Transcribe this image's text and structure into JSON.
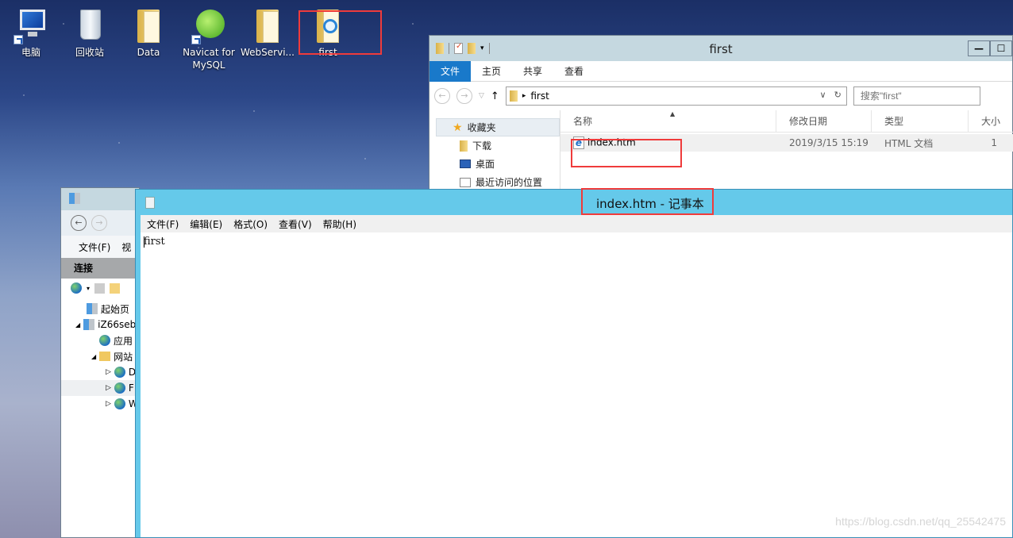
{
  "desktop": {
    "icons": [
      {
        "label": "电脑",
        "icon": "computer-icon",
        "shortcut": true
      },
      {
        "label": "回收站",
        "icon": "recycle-bin-icon",
        "shortcut": false
      },
      {
        "label": "Data",
        "icon": "folder-icon",
        "shortcut": false
      },
      {
        "label": "Navicat for MySQL",
        "icon": "navicat-icon",
        "shortcut": true
      },
      {
        "label": "WebServi...",
        "icon": "folder-icon",
        "shortcut": false
      },
      {
        "label": "first",
        "icon": "folder-ie-icon",
        "shortcut": false
      }
    ],
    "highlight_color": "#ef3b3b"
  },
  "explorer": {
    "title": "first",
    "ribbon_tabs": [
      "文件",
      "主页",
      "共享",
      "查看"
    ],
    "address": {
      "crumb_arrow": "▸",
      "path": "first"
    },
    "search_placeholder": "搜索\"first\"",
    "sidebar": [
      {
        "label": "收藏夹",
        "icon": "star-icon"
      },
      {
        "label": "下载",
        "icon": "download-folder-icon"
      },
      {
        "label": "桌面",
        "icon": "desktop-icon"
      },
      {
        "label": "最近访问的位置",
        "icon": "recent-places-icon"
      }
    ],
    "columns": [
      "名称",
      "修改日期",
      "类型",
      "大小"
    ],
    "files": [
      {
        "name": "index.htm",
        "modified": "2019/3/15 15:19",
        "type": "HTML 文档",
        "size": "1"
      }
    ],
    "accent": "#1979ca"
  },
  "iis": {
    "menu": [
      "文件(F)",
      "视"
    ],
    "connections_label": "连接",
    "tree": [
      {
        "label": "起始页",
        "level": 0
      },
      {
        "label": "iZ66seb",
        "level": 0
      },
      {
        "label": "应用",
        "level": 1
      },
      {
        "label": "网站",
        "level": 1
      },
      {
        "label": "D",
        "level": 2
      },
      {
        "label": "F",
        "level": 2
      },
      {
        "label": "W",
        "level": 2
      }
    ]
  },
  "notepad": {
    "title": "index.htm - 记事本",
    "menu": [
      "文件(F)",
      "编辑(E)",
      "格式(O)",
      "查看(V)",
      "帮助(H)"
    ],
    "content": "first",
    "title_color": "#65c9ea"
  },
  "watermark": "https://blog.csdn.net/qq_25542475"
}
